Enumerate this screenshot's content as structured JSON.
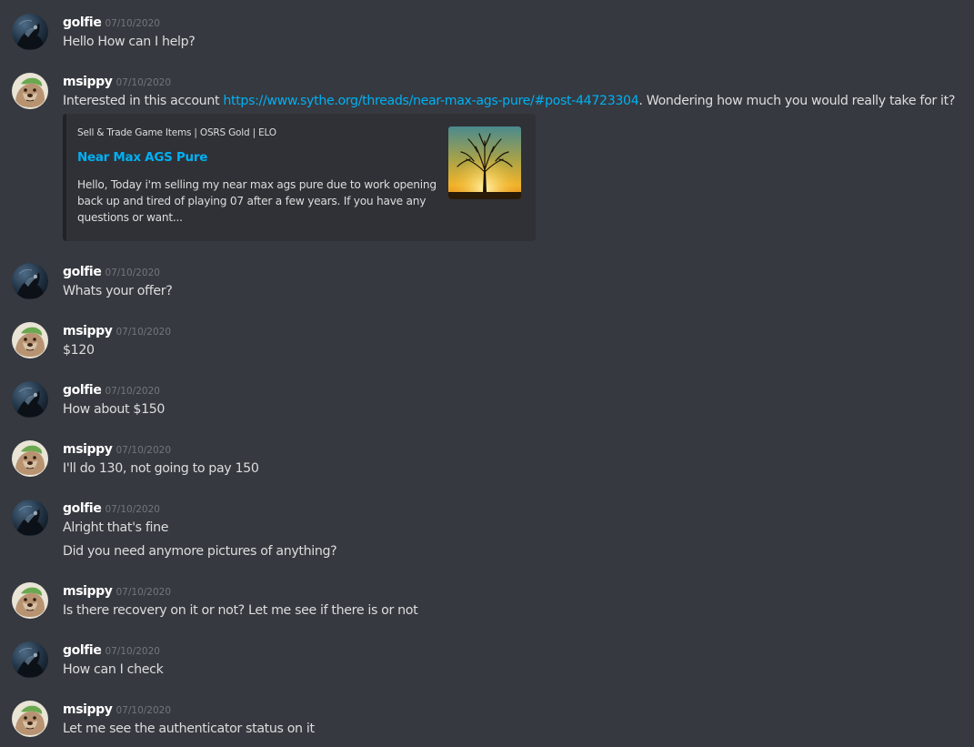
{
  "messages": [
    {
      "author": "golfie",
      "timestamp": "07/10/2020",
      "lines": [
        "Hello How can I help?"
      ]
    },
    {
      "author": "msippy",
      "timestamp": "07/10/2020",
      "text_before": "Interested in this account ",
      "link": "https://www.sythe.org/threads/near-max-ags-pure/#post-44723304",
      "text_after": ". Wondering how much you would really take for it?",
      "embed": {
        "provider": "Sell & Trade Game Items | OSRS Gold | ELO",
        "title": "Near Max AGS Pure",
        "description": "Hello, Today i'm selling my near max ags pure due to work opening back up and tired of playing 07 after a few years. If you have any questions or want...",
        "thumbnail_icon": "tree-sunset-thumbnail"
      }
    },
    {
      "author": "golfie",
      "timestamp": "07/10/2020",
      "lines": [
        "Whats your offer?"
      ]
    },
    {
      "author": "msippy",
      "timestamp": "07/10/2020",
      "lines": [
        "$120"
      ]
    },
    {
      "author": "golfie",
      "timestamp": "07/10/2020",
      "lines": [
        "How about $150"
      ]
    },
    {
      "author": "msippy",
      "timestamp": "07/10/2020",
      "lines": [
        "I'll do 130, not going to pay 150"
      ]
    },
    {
      "author": "golfie",
      "timestamp": "07/10/2020",
      "lines": [
        "Alright that's fine",
        "Did you need anymore pictures of anything?"
      ]
    },
    {
      "author": "msippy",
      "timestamp": "07/10/2020",
      "lines": [
        "Is there recovery on it or not? Let me see if there is or not"
      ]
    },
    {
      "author": "golfie",
      "timestamp": "07/10/2020",
      "lines": [
        "How can I check"
      ]
    },
    {
      "author": "msippy",
      "timestamp": "07/10/2020",
      "lines": [
        "Let me see the authenticator status on it"
      ]
    }
  ],
  "colors": {
    "background": "#36393f",
    "username": "#ffffff",
    "timestamp": "#72767d",
    "text": "#dcddde",
    "link": "#00b0f4",
    "embed_background": "#2f3136",
    "embed_border": "#202225"
  }
}
